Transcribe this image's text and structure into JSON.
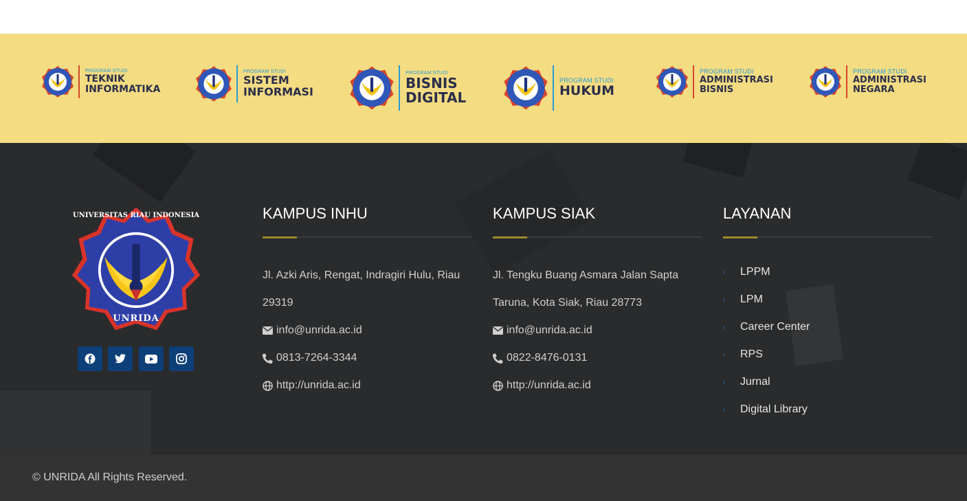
{
  "programs": [
    {
      "small": "PROGRAM STUDI",
      "line1": "TEKNIK",
      "line2": "INFORMATIKA"
    },
    {
      "small": "PROGRAM STUDI",
      "line1": "SISTEM",
      "line2": "INFORMASI"
    },
    {
      "small": "PROGRAM STUDI",
      "line1": "BISNIS",
      "line2": "DIGITAL"
    },
    {
      "small": "PROGRAM STUDI",
      "line1": "HUKUM",
      "line2": ""
    },
    {
      "small": "PROGRAM STUDI",
      "line1": "ADMINISTRASI",
      "line2": "BISNIS"
    },
    {
      "small": "PROGRAM STUDI",
      "line1": "ADMINISTRASI",
      "line2": "NEGARA"
    }
  ],
  "logo": {
    "ring_text": "UNIVERSITAS RIAU INDONESIA",
    "bottom_text": "UNRIDA"
  },
  "kampus_inhu": {
    "title": "KAMPUS INHU",
    "address_1": "Jl. Azki Aris, Rengat, Indragiri Hulu, Riau",
    "address_2": "29319",
    "email": "info@unrida.ac.id",
    "phone": "0813-7264-3344",
    "web": "http://unrida.ac.id"
  },
  "kampus_siak": {
    "title": "KAMPUS SIAK",
    "address_1": "Jl. Tengku Buang Asmara Jalan Sapta",
    "address_2": "Taruna, Kota Siak, Riau 28773",
    "email": "info@unrida.ac.id",
    "phone": "0822-8476-0131",
    "web": "http://unrida.ac.id"
  },
  "layanan": {
    "title": "LAYANAN",
    "items": [
      "LPPM",
      "LPM",
      "Career Center",
      "RPS",
      "Jurnal",
      "Digital Library"
    ]
  },
  "footer": {
    "copyright": "© UNRIDA All Rights Reserved."
  },
  "colors": {
    "banner": "#f3dc82",
    "footer_bg": "#2a2b2c",
    "social_bg": "#0d3f78",
    "accent": "#9a8a2f"
  }
}
